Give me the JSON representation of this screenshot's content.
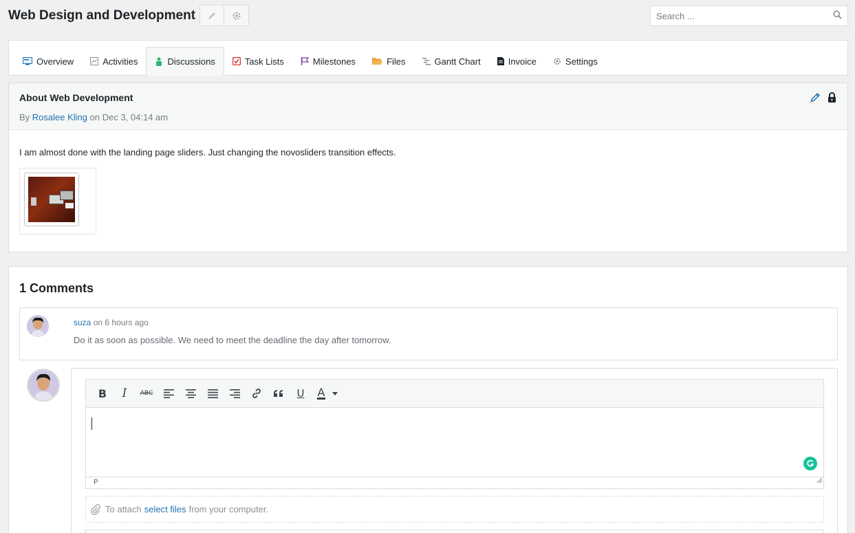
{
  "header": {
    "project_title": "Web Design and Development",
    "search_placeholder": "Search ..."
  },
  "tabs": [
    {
      "label": "Overview",
      "icon": "overview-icon"
    },
    {
      "label": "Activities",
      "icon": "activities-icon"
    },
    {
      "label": "Discussions",
      "icon": "discussions-icon",
      "active": true
    },
    {
      "label": "Task Lists",
      "icon": "task-list-icon"
    },
    {
      "label": "Milestones",
      "icon": "milestone-flag-icon"
    },
    {
      "label": "Files",
      "icon": "folder-icon"
    },
    {
      "label": "Gantt Chart",
      "icon": "gantt-icon"
    },
    {
      "label": "Invoice",
      "icon": "invoice-icon"
    },
    {
      "label": "Settings",
      "icon": "gear-icon"
    }
  ],
  "discussion": {
    "title": "About Web Development",
    "by_label": "By",
    "author": "Rosalee Kling",
    "date_text": "on Dec 3, 04:14 am",
    "body": "I am almost done with the landing page sliders. Just changing the novosliders transition effects."
  },
  "comments": {
    "heading": "1 Comments",
    "items": [
      {
        "author": "suza",
        "time_text": "on 6 hours ago",
        "text": "Do it as soon as possible. We need to meet the deadline the day after tomorrow."
      }
    ]
  },
  "editor": {
    "path_label": "P",
    "toolbar": [
      "bold",
      "italic",
      "strikethrough",
      "align-left",
      "align-center",
      "align-justify",
      "align-right",
      "link",
      "blockquote",
      "underline",
      "text-color"
    ]
  },
  "attach": {
    "prefix": "To attach",
    "link": "select files",
    "suffix": "from your computer."
  },
  "colors": {
    "link": "#2271b1",
    "background": "#f0f0f1",
    "grammarly": "#15c39a"
  }
}
